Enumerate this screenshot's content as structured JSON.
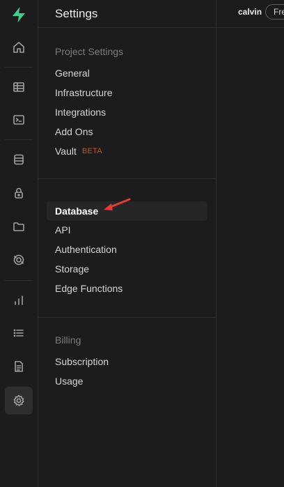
{
  "header": {
    "title": "Settings"
  },
  "topbar": {
    "user": "calvin",
    "plan": "Fre"
  },
  "sections": {
    "project": {
      "title": "Project Settings",
      "items": [
        "General",
        "Infrastructure",
        "Integrations",
        "Add Ons",
        "Vault"
      ],
      "vault_badge": "BETA"
    },
    "configuration": {
      "items": [
        "Database",
        "API",
        "Authentication",
        "Storage",
        "Edge Functions"
      ],
      "active": "Database"
    },
    "billing": {
      "title": "Billing",
      "items": [
        "Subscription",
        "Usage"
      ]
    }
  },
  "rail": {
    "icons": [
      "home-icon",
      "table-icon",
      "terminal-icon",
      "database-icon",
      "lock-icon",
      "folder-icon",
      "realtime-icon",
      "reports-icon",
      "logs-icon",
      "docs-icon",
      "settings-icon"
    ],
    "active": "settings-icon"
  },
  "colors": {
    "brand": "#3ecf8e",
    "beta": "#c2561d",
    "annotation": "#e53935"
  }
}
